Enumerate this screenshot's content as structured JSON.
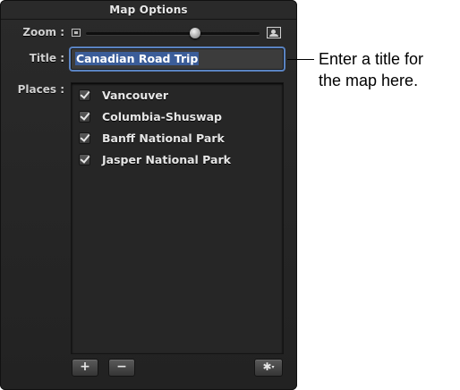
{
  "panel": {
    "title": "Map Options"
  },
  "zoom": {
    "label": "Zoom :",
    "value_fraction": 0.63,
    "min_icon": "small-picture-icon",
    "max_icon": "large-picture-icon"
  },
  "title_field": {
    "label": "Title :",
    "value": "Canadian Road Trip",
    "focus_color": "#5a83c2"
  },
  "places": {
    "label": "Places :",
    "items": [
      {
        "label": "Vancouver",
        "checked": true
      },
      {
        "label": "Columbia-Shuswap",
        "checked": true
      },
      {
        "label": "Banff National Park",
        "checked": true
      },
      {
        "label": "Jasper National Park",
        "checked": true
      }
    ]
  },
  "buttons": {
    "add": "+",
    "remove": "−",
    "gear": "✱",
    "gear_caret": "▾",
    "gear_icon": "gear-icon"
  },
  "callout": {
    "line1": "Enter a title for",
    "line2": "the map here."
  }
}
